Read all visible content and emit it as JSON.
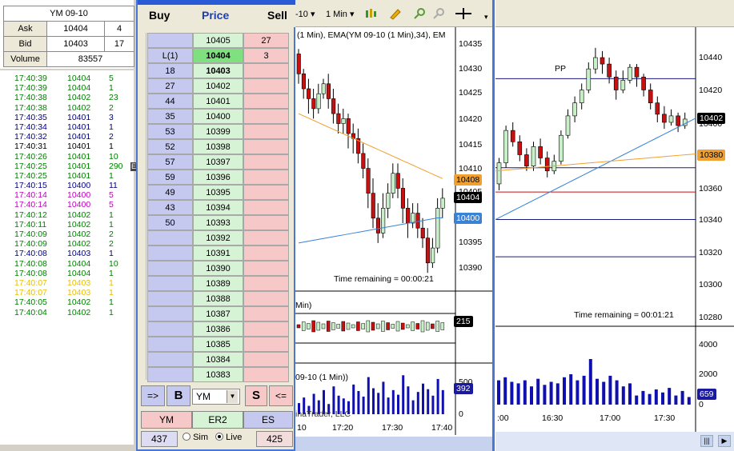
{
  "time_sales": {
    "title": "YM 09-10",
    "ask_label": "Ask",
    "ask_price": "10404",
    "ask_size": "4",
    "bid_label": "Bid",
    "bid_price": "10403",
    "bid_size": "17",
    "volume_label": "Volume",
    "volume": "83557",
    "marker": "E",
    "trades": [
      {
        "t": "17:40:39",
        "p": "10404",
        "s": "5",
        "c": "#008000"
      },
      {
        "t": "17:40:39",
        "p": "10404",
        "s": "1",
        "c": "#008000"
      },
      {
        "t": "17:40:38",
        "p": "10402",
        "s": "23",
        "c": "#008000"
      },
      {
        "t": "17:40:38",
        "p": "10402",
        "s": "2",
        "c": "#008000"
      },
      {
        "t": "17:40:35",
        "p": "10401",
        "s": "3",
        "c": "#000080"
      },
      {
        "t": "17:40:34",
        "p": "10401",
        "s": "1",
        "c": "#000080"
      },
      {
        "t": "17:40:32",
        "p": "10401",
        "s": "2",
        "c": "#000080"
      },
      {
        "t": "17:40:31",
        "p": "10401",
        "s": "1",
        "c": "#000000"
      },
      {
        "t": "17:40:26",
        "p": "10401",
        "s": "10",
        "c": "#008000"
      },
      {
        "t": "17:40:25",
        "p": "10401",
        "s": "290",
        "c": "#008000"
      },
      {
        "t": "17:40:25",
        "p": "10401",
        "s": "1",
        "c": "#008000"
      },
      {
        "t": "17:40:15",
        "p": "10400",
        "s": "11",
        "c": "#000080"
      },
      {
        "t": "17:40:14",
        "p": "10400",
        "s": "5",
        "c": "#c000c0"
      },
      {
        "t": "17:40:14",
        "p": "10400",
        "s": "5",
        "c": "#c000c0"
      },
      {
        "t": "17:40:12",
        "p": "10402",
        "s": "1",
        "c": "#008000"
      },
      {
        "t": "17:40:11",
        "p": "10402",
        "s": "1",
        "c": "#008000"
      },
      {
        "t": "17:40:09",
        "p": "10402",
        "s": "2",
        "c": "#008000"
      },
      {
        "t": "17:40:09",
        "p": "10402",
        "s": "2",
        "c": "#008000"
      },
      {
        "t": "17:40:08",
        "p": "10403",
        "s": "1",
        "c": "#000080"
      },
      {
        "t": "17:40:08",
        "p": "10404",
        "s": "10",
        "c": "#008000"
      },
      {
        "t": "17:40:08",
        "p": "10404",
        "s": "1",
        "c": "#008000"
      },
      {
        "t": "17:40:07",
        "p": "10403",
        "s": "1",
        "c": "#e8c000"
      },
      {
        "t": "17:40:07",
        "p": "10403",
        "s": "1",
        "c": "#e8c000"
      },
      {
        "t": "17:40:05",
        "p": "10402",
        "s": "1",
        "c": "#008000"
      },
      {
        "t": "17:40:04",
        "p": "10402",
        "s": "1",
        "c": "#008000"
      }
    ]
  },
  "dom": {
    "buy_header": "Buy",
    "price_header": "Price",
    "sell_header": "Sell",
    "rows": [
      {
        "buy": "",
        "price": "10405",
        "sell": "27"
      },
      {
        "buy": "L(1)",
        "price": "10404",
        "sell": "3"
      },
      {
        "buy": "18",
        "price": "10403",
        "sell": ""
      },
      {
        "buy": "27",
        "price": "10402",
        "sell": ""
      },
      {
        "buy": "44",
        "price": "10401",
        "sell": ""
      },
      {
        "buy": "35",
        "price": "10400",
        "sell": ""
      },
      {
        "buy": "53",
        "price": "10399",
        "sell": ""
      },
      {
        "buy": "52",
        "price": "10398",
        "sell": ""
      },
      {
        "buy": "57",
        "price": "10397",
        "sell": ""
      },
      {
        "buy": "59",
        "price": "10396",
        "sell": ""
      },
      {
        "buy": "49",
        "price": "10395",
        "sell": ""
      },
      {
        "buy": "43",
        "price": "10394",
        "sell": ""
      },
      {
        "buy": "50",
        "price": "10393",
        "sell": ""
      },
      {
        "buy": "",
        "price": "10392",
        "sell": ""
      },
      {
        "buy": "",
        "price": "10391",
        "sell": ""
      },
      {
        "buy": "",
        "price": "10390",
        "sell": ""
      },
      {
        "buy": "",
        "price": "10389",
        "sell": ""
      },
      {
        "buy": "",
        "price": "10388",
        "sell": ""
      },
      {
        "buy": "",
        "price": "10387",
        "sell": ""
      },
      {
        "buy": "",
        "price": "10386",
        "sell": ""
      },
      {
        "buy": "",
        "price": "10385",
        "sell": ""
      },
      {
        "buy": "",
        "price": "10384",
        "sell": ""
      },
      {
        "buy": "",
        "price": "10383",
        "sell": ""
      }
    ],
    "last_price": "10404",
    "bold_price": "10403",
    "btn_reverse": "=>",
    "btn_buy": "B",
    "instrument": "YM",
    "btn_sell": "S",
    "btn_close": "<=",
    "inst_tabs": [
      "YM",
      "ER2",
      "ES"
    ],
    "foot_left": "437",
    "sim_label": "Sim",
    "live_label": "Live",
    "foot_right": "425",
    "colors": {
      "buy": "#c5c9f0",
      "price": "#d6f3d6",
      "sell": "#f7c8c8",
      "last": "#7fe07f"
    }
  },
  "chart1": {
    "toolbar": {
      "instrument_suffix": "-10",
      "interval": "1 Min"
    },
    "title": "(1 Min), EMA(YM 09-10 (1 Min),34), EM",
    "price_labels": [
      "10435",
      "10430",
      "10425",
      "10420",
      "10415",
      "10410",
      "10405",
      "10400",
      "10395",
      "10390"
    ],
    "tags": {
      "orange": "10408",
      "black": "10404",
      "blue": "10400"
    },
    "time_remaining": "Time remaining = 00:00:21",
    "panel2_title": "Min)",
    "panel2_tag": "215",
    "panel3_title": "09-10 (1 Min))",
    "vol_labels": [
      "500",
      "0"
    ],
    "vol_tag": "392",
    "watermark": "inaTrader, LLC",
    "time_labels": [
      "10",
      "17:20",
      "17:30",
      "17:40"
    ]
  },
  "chart2": {
    "pp_label": "PP",
    "price_labels": [
      "10440",
      "10420",
      "10400",
      "10380",
      "10360",
      "10340",
      "10320",
      "10300",
      "10280"
    ],
    "tags": {
      "black": "10402",
      "orange": "10380"
    },
    "time_remaining": "Time remaining = 00:01:21",
    "vol_labels": [
      "4000",
      "2000",
      "0"
    ],
    "vol_tag": "659",
    "time_labels": [
      ":00",
      "16:30",
      "17:00",
      "17:30"
    ]
  }
}
